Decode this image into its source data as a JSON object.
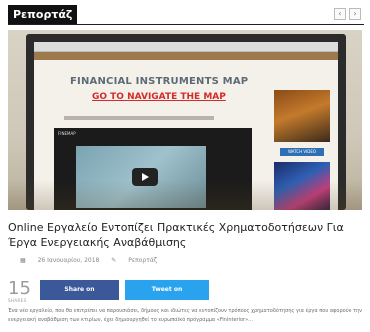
{
  "widget": {
    "badge_label": "Ρεπορτάζ",
    "nav": {
      "prev_glyph": "‹",
      "next_glyph": "›"
    }
  },
  "photo_content": {
    "map_title": "FINANCIAL INSTRUMENTS MAP",
    "map_link": "GO TO NAVIGATE THE MAP",
    "video_label": "FINEMAP",
    "thumb_button": "WATCH VIDEO"
  },
  "article": {
    "headline": "Online Εργαλείο Εντοπίζει Πρακτικές Χρηματοδοτήσεων Για Έργα Ενεργειακής Αναβάθμισης",
    "date": "26 Ιανουαρίου, 2018",
    "category": "Ρεπορτάζ",
    "excerpt": "Ένα νέο εργαλείο, που θα επιτρέπει να παρουσιάσει, δήμους και ιδιώτες να εντοπίζουν τρόπους χρηματοδότησης για έργα που αφορούν την ενεργειακή αναβάθμιση των κτιρίων, έχει δημιουργηθεί το ευρωπαϊκό πρόγραμμα «Fininterior»..."
  },
  "share": {
    "count": "15",
    "label": "SHARES",
    "facebook_label": "Share on",
    "twitter_label": "Tweet on"
  },
  "colors": {
    "facebook": "#3b5998",
    "twitter": "#2aa3ef",
    "badge_bg": "#111111",
    "map_link": "#d42a2a"
  },
  "icons": {
    "date": "calendar-icon",
    "category": "folder-icon",
    "facebook": "facebook-icon",
    "twitter": "twitter-icon"
  }
}
